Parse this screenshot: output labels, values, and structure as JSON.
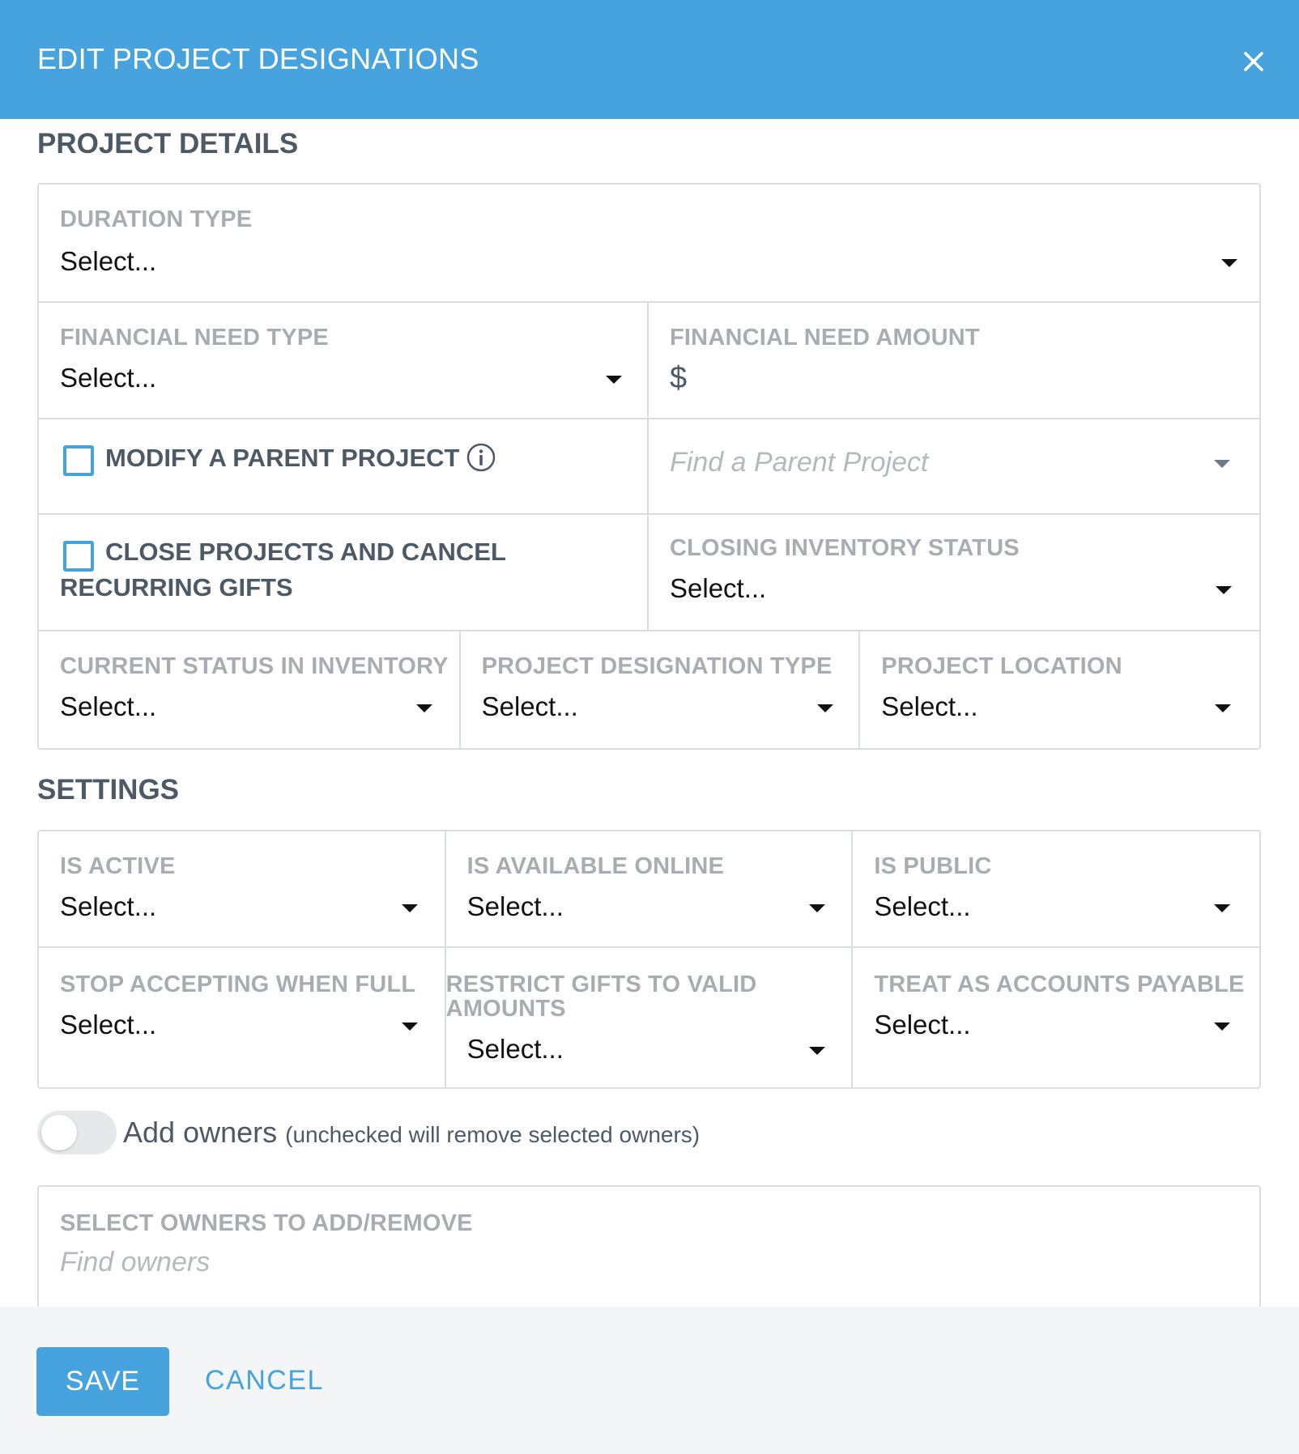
{
  "modal": {
    "title": "EDIT PROJECT DESIGNATIONS"
  },
  "project_details": {
    "heading": "PROJECT DETAILS",
    "duration_type": {
      "label": "DURATION TYPE",
      "value": "Select..."
    },
    "financial_need_type": {
      "label": "FINANCIAL NEED TYPE",
      "value": "Select..."
    },
    "financial_need_amount": {
      "label": "FINANCIAL NEED AMOUNT",
      "currency": "$"
    },
    "modify_parent": {
      "label": "MODIFY A PARENT PROJECT",
      "checked": false
    },
    "parent_search": {
      "placeholder": "Find a Parent Project"
    },
    "close_projects": {
      "label": "CLOSE PROJECTS AND CANCEL RECURRING GIFTS",
      "checked": false
    },
    "closing_inventory_status": {
      "label": "CLOSING INVENTORY STATUS",
      "value": "Select..."
    },
    "current_status": {
      "label": "CURRENT STATUS IN INVENTORY",
      "value": "Select..."
    },
    "designation_type": {
      "label": "PROJECT DESIGNATION TYPE",
      "value": "Select..."
    },
    "project_location": {
      "label": "PROJECT LOCATION",
      "value": "Select..."
    }
  },
  "settings": {
    "heading": "SETTINGS",
    "is_active": {
      "label": "IS ACTIVE",
      "value": "Select..."
    },
    "is_available_online": {
      "label": "IS AVAILABLE ONLINE",
      "value": "Select..."
    },
    "is_public": {
      "label": "IS PUBLIC",
      "value": "Select..."
    },
    "stop_accepting": {
      "label": "STOP ACCEPTING WHEN FULL",
      "value": "Select..."
    },
    "restrict_gifts": {
      "label": "RESTRICT GIFTS TO VALID AMOUNTS",
      "value": "Select..."
    },
    "treat_as_payable": {
      "label": "TREAT AS ACCOUNTS PAYABLE",
      "value": "Select..."
    }
  },
  "owners": {
    "toggle_label": "Add owners",
    "toggle_note": "(unchecked will remove selected owners)",
    "toggle_on": false,
    "select_label": "SELECT OWNERS TO ADD/REMOVE",
    "placeholder": "Find owners"
  },
  "footer": {
    "save_label": "SAVE",
    "cancel_label": "CANCEL"
  },
  "colors": {
    "accent": "#47a3de",
    "label": "#a9adb2",
    "heading": "#4d5a66",
    "border": "#d9dde2"
  }
}
